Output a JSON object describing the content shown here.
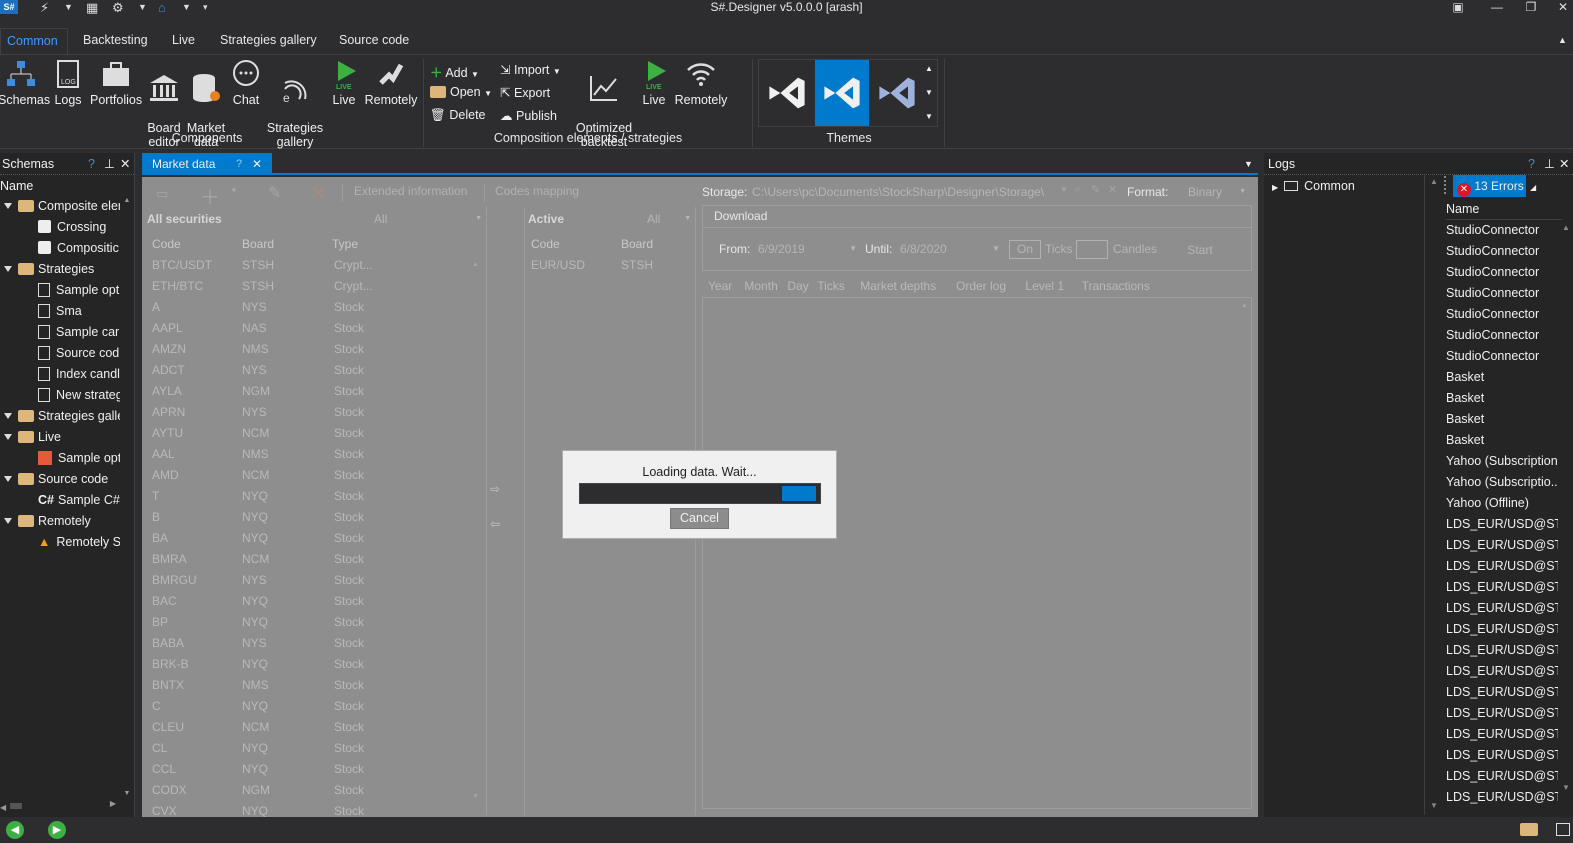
{
  "window": {
    "title": "S#.Designer v5.0.0.0 [arash]",
    "app_icon": "S#"
  },
  "tabs": [
    "Common",
    "Backtesting",
    "Live",
    "Strategies gallery",
    "Source code"
  ],
  "ribbon": {
    "components": {
      "buttons": [
        {
          "label": "Schemas"
        },
        {
          "label": "Logs"
        },
        {
          "label": "Portfolios"
        },
        {
          "label": "Board\neditor"
        },
        {
          "label": "Market\ndata"
        },
        {
          "label": "Chat"
        },
        {
          "label": "Strategies\ngallery"
        },
        {
          "label": "Live"
        },
        {
          "label": "Remotely"
        }
      ],
      "group_label": "Components"
    },
    "composition": {
      "small": [
        "Add",
        "Open",
        "Delete",
        "Import",
        "Export",
        "Publish"
      ],
      "buttons": [
        "Optimized\nbacktest",
        "Live",
        "Remotely"
      ],
      "group_label": "Composition elements / strategies"
    },
    "themes": {
      "group_label": "Themes"
    }
  },
  "schemas_panel": {
    "title": "Schemas",
    "column": "Name",
    "items": [
      {
        "label": "Composite eler",
        "type": "folder",
        "level": 0
      },
      {
        "label": "Crossing",
        "type": "puzzle",
        "level": 1
      },
      {
        "label": "Compositic",
        "type": "puzzle",
        "level": 1
      },
      {
        "label": "Strategies",
        "type": "folder",
        "level": 0
      },
      {
        "label": "Sample opt",
        "type": "doc",
        "level": 1
      },
      {
        "label": "Sma",
        "type": "doc",
        "level": 1
      },
      {
        "label": "Sample car",
        "type": "doc",
        "level": 1
      },
      {
        "label": "Source cod",
        "type": "doc",
        "level": 1
      },
      {
        "label": "Index candl",
        "type": "doc",
        "level": 1
      },
      {
        "label": "New strateg",
        "type": "doc",
        "level": 1
      },
      {
        "label": "Strategies galle",
        "type": "folder",
        "level": 0
      },
      {
        "label": "Live",
        "type": "folder",
        "level": 0
      },
      {
        "label": "Sample opt",
        "type": "red",
        "level": 1
      },
      {
        "label": "Source code",
        "type": "folder",
        "level": 0
      },
      {
        "label": "Sample C#",
        "type": "csharp",
        "level": 1
      },
      {
        "label": "Remotely",
        "type": "folder",
        "level": 0
      },
      {
        "label": "Remotely S",
        "type": "warning",
        "level": 1
      }
    ]
  },
  "market_data": {
    "tab": "Market data",
    "toolbar": {
      "extended": "Extended information",
      "codes": "Codes mapping"
    },
    "all_securities": {
      "title": "All securities",
      "filter": "All",
      "columns": [
        "Code",
        "Board",
        "Type"
      ],
      "rows": [
        [
          "BTC/USDT",
          "STSH",
          "Crypt..."
        ],
        [
          "ETH/BTC",
          "STSH",
          "Crypt..."
        ],
        [
          "A",
          "NYS",
          "Stock"
        ],
        [
          "AAPL",
          "NAS",
          "Stock"
        ],
        [
          "AMZN",
          "NMS",
          "Stock"
        ],
        [
          "ADCT",
          "NYS",
          "Stock"
        ],
        [
          "AYLA",
          "NGM",
          "Stock"
        ],
        [
          "APRN",
          "NYS",
          "Stock"
        ],
        [
          "AYTU",
          "NCM",
          "Stock"
        ],
        [
          "AAL",
          "NMS",
          "Stock"
        ],
        [
          "AMD",
          "NCM",
          "Stock"
        ],
        [
          "T",
          "NYQ",
          "Stock"
        ],
        [
          "B",
          "NYQ",
          "Stock"
        ],
        [
          "BA",
          "NYQ",
          "Stock"
        ],
        [
          "BMRA",
          "NCM",
          "Stock"
        ],
        [
          "BMRGU",
          "NYS",
          "Stock"
        ],
        [
          "BAC",
          "NYQ",
          "Stock"
        ],
        [
          "BP",
          "NYQ",
          "Stock"
        ],
        [
          "BABA",
          "NYS",
          "Stock"
        ],
        [
          "BRK-B",
          "NYQ",
          "Stock"
        ],
        [
          "BNTX",
          "NMS",
          "Stock"
        ],
        [
          "C",
          "NYQ",
          "Stock"
        ],
        [
          "CLEU",
          "NCM",
          "Stock"
        ],
        [
          "CL",
          "NYQ",
          "Stock"
        ],
        [
          "CCL",
          "NYQ",
          "Stock"
        ],
        [
          "CODX",
          "NGM",
          "Stock"
        ],
        [
          "CVX",
          "NYQ",
          "Stock"
        ]
      ]
    },
    "active": {
      "title": "Active",
      "filter": "All",
      "columns": [
        "Code",
        "Board"
      ],
      "rows": [
        [
          "EUR/USD",
          "STSH"
        ]
      ]
    },
    "storage": {
      "label": "Storage:",
      "path": "C:\\Users\\pc\\Documents\\StockSharp\\Designer\\Storage\\",
      "format_label": "Format:",
      "format": "Binary"
    },
    "download": {
      "title": "Download",
      "from_label": "From:",
      "from": "6/9/2019",
      "until_label": "Until:",
      "until": "6/8/2020",
      "on": "On",
      "ticks": "Ticks",
      "candles": "Candles",
      "start": "Start"
    },
    "data_tabs": [
      "Year",
      "Month",
      "Day",
      "Ticks",
      "Market depths",
      "Order log",
      "Level 1",
      "Transactions"
    ]
  },
  "dialog": {
    "message": "Loading data. Wait...",
    "cancel": "Cancel",
    "progress": 0.14
  },
  "logs_panel": {
    "title": "Logs",
    "tree_item": "Common",
    "errors": "13 Errors",
    "column": "Name",
    "rows": [
      "StudioConnector",
      "StudioConnector",
      "StudioConnector",
      "StudioConnector",
      "StudioConnector",
      "StudioConnector",
      "StudioConnector",
      "Basket",
      "Basket",
      "Basket",
      "Basket",
      "Yahoo (Subscription)",
      "Yahoo (Subscriptio...",
      "Yahoo (Offline)",
      "LDS_EUR/USD@ST...",
      "LDS_EUR/USD@ST...",
      "LDS_EUR/USD@ST...",
      "LDS_EUR/USD@ST...",
      "LDS_EUR/USD@ST...",
      "LDS_EUR/USD@ST...",
      "LDS_EUR/USD@ST...",
      "LDS_EUR/USD@ST...",
      "LDS_EUR/USD@ST...",
      "LDS_EUR/USD@ST...",
      "LDS_EUR/USD@ST...",
      "LDS_EUR/USD@ST...",
      "LDS_EUR/USD@ST...",
      "LDS_EUR/USD@ST..."
    ]
  },
  "colors": {
    "accent": "#007acc",
    "bg": "#2d2d30",
    "overlay": "#8e8e8e",
    "error": "#e81123"
  }
}
